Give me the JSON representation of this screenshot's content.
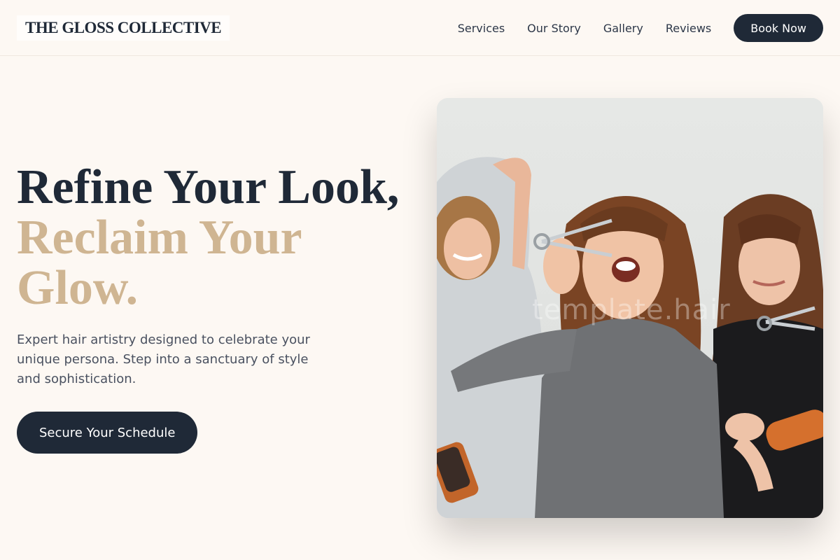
{
  "brand": {
    "name": "THE GLOSS COLLECTIVE"
  },
  "nav": {
    "links": [
      "Services",
      "Our Story",
      "Gallery",
      "Reviews"
    ],
    "cta_label": "Book Now"
  },
  "hero": {
    "headline_line1": "Refine Your Look,",
    "headline_line2": "Reclaim Your",
    "headline_line3": "Glow.",
    "subtext": "Expert hair artistry designed to celebrate your unique persona. Step into a sanctuary of style and sophistication.",
    "cta_label": "Secure Your Schedule",
    "image": {
      "description": "three smiling hair stylists holding scissors and brushes",
      "watermark": "template.hair"
    }
  },
  "colors": {
    "background": "#fdf8f3",
    "primary": "#1f2937",
    "accent": "#cfb592"
  }
}
